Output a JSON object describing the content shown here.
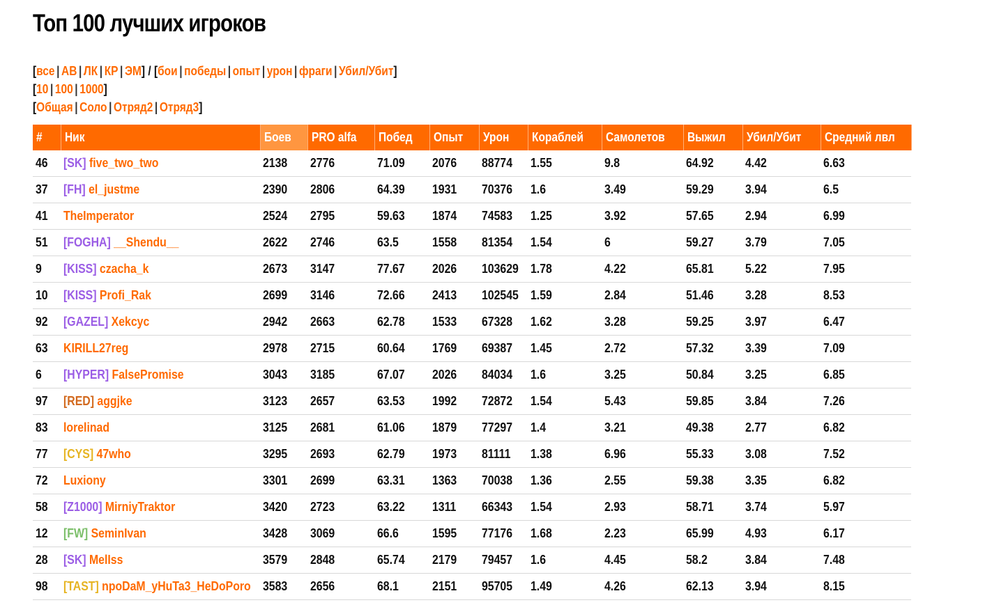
{
  "title": "Топ 100 лучших игроков",
  "filters": {
    "row1": [
      {
        "type": "br",
        "text": "["
      },
      {
        "type": "link",
        "text": "все"
      },
      {
        "type": "sep",
        "text": "|"
      },
      {
        "type": "link",
        "text": "АВ"
      },
      {
        "type": "sep",
        "text": "|"
      },
      {
        "type": "link",
        "text": "ЛК"
      },
      {
        "type": "sep",
        "text": "|"
      },
      {
        "type": "link",
        "text": "КР"
      },
      {
        "type": "sep",
        "text": "|"
      },
      {
        "type": "link",
        "text": "ЭМ"
      },
      {
        "type": "br",
        "text": "] / ["
      },
      {
        "type": "link",
        "text": "бои"
      },
      {
        "type": "sep",
        "text": "|"
      },
      {
        "type": "link",
        "text": "победы"
      },
      {
        "type": "sep",
        "text": "|"
      },
      {
        "type": "link",
        "text": "опыт"
      },
      {
        "type": "sep",
        "text": "|"
      },
      {
        "type": "link",
        "text": "урон"
      },
      {
        "type": "sep",
        "text": "|"
      },
      {
        "type": "link",
        "text": "фраги"
      },
      {
        "type": "sep",
        "text": "|"
      },
      {
        "type": "link",
        "text": "Убил/Убит"
      },
      {
        "type": "br",
        "text": "]"
      }
    ],
    "row2": [
      {
        "type": "br",
        "text": "["
      },
      {
        "type": "link",
        "text": "10"
      },
      {
        "type": "sep",
        "text": "|"
      },
      {
        "type": "link",
        "text": "100"
      },
      {
        "type": "sep",
        "text": "|"
      },
      {
        "type": "link",
        "text": "1000"
      },
      {
        "type": "br",
        "text": "]"
      }
    ],
    "row3": [
      {
        "type": "br",
        "text": "["
      },
      {
        "type": "link",
        "text": "Общая"
      },
      {
        "type": "sep",
        "text": "|"
      },
      {
        "type": "link",
        "text": "Соло"
      },
      {
        "type": "sep",
        "text": "|"
      },
      {
        "type": "link",
        "text": "Отряд2"
      },
      {
        "type": "sep",
        "text": "|"
      },
      {
        "type": "link",
        "text": "Отряд3"
      },
      {
        "type": "br",
        "text": "]"
      }
    ]
  },
  "table": {
    "headers": [
      "#",
      "Ник",
      "Боев",
      "PRO alfa",
      "Побед",
      "Опыт",
      "Урон",
      "Кораблей",
      "Самолетов",
      "Выжил",
      "Убил/Убит",
      "Средний лвл"
    ],
    "highlight_header": "Боев",
    "colors": {
      "header_bg": "#ff6a00",
      "highlight_bg": "#ff9640",
      "nick": "#ff6a00",
      "pro": "#9b3bb0",
      "clan_purple": "#9b5de5",
      "clan_orange": "#d2691e",
      "clan_yellow": "#e6b422",
      "clan_green": "#7cbf6a"
    },
    "rows": [
      {
        "rank": "46",
        "clan": "[SK]",
        "clan_color": "#9b5de5",
        "nick": "five_two_two",
        "battles": "2138",
        "pro": "2776",
        "wins": "71.09",
        "exp": "2076",
        "dmg": "88774",
        "ships": "1.55",
        "planes": "9.8",
        "survived": "64.92",
        "kd": "4.42",
        "lvl": "6.63"
      },
      {
        "rank": "37",
        "clan": "[FH]",
        "clan_color": "#9b5de5",
        "nick": "el_justme",
        "battles": "2390",
        "pro": "2806",
        "wins": "64.39",
        "exp": "1931",
        "dmg": "70376",
        "ships": "1.6",
        "planes": "3.49",
        "survived": "59.29",
        "kd": "3.94",
        "lvl": "6.5"
      },
      {
        "rank": "41",
        "clan": "",
        "clan_color": "",
        "nick": "TheImperator",
        "battles": "2524",
        "pro": "2795",
        "wins": "59.63",
        "exp": "1874",
        "dmg": "74583",
        "ships": "1.25",
        "planes": "3.92",
        "survived": "57.65",
        "kd": "2.94",
        "lvl": "6.99"
      },
      {
        "rank": "51",
        "clan": "[FOGHA]",
        "clan_color": "#9b5de5",
        "nick": "__Shendu__",
        "battles": "2622",
        "pro": "2746",
        "wins": "63.5",
        "exp": "1558",
        "dmg": "81354",
        "ships": "1.54",
        "planes": "6",
        "survived": "59.27",
        "kd": "3.79",
        "lvl": "7.05"
      },
      {
        "rank": "9",
        "clan": "[KISS]",
        "clan_color": "#9b5de5",
        "nick": "czacha_k",
        "battles": "2673",
        "pro": "3147",
        "wins": "77.67",
        "exp": "2026",
        "dmg": "103629",
        "ships": "1.78",
        "planes": "4.22",
        "survived": "65.81",
        "kd": "5.22",
        "lvl": "7.95"
      },
      {
        "rank": "10",
        "clan": "[KISS]",
        "clan_color": "#9b5de5",
        "nick": "Profi_Rak",
        "battles": "2699",
        "pro": "3146",
        "wins": "72.66",
        "exp": "2413",
        "dmg": "102545",
        "ships": "1.59",
        "planes": "2.84",
        "survived": "51.46",
        "kd": "3.28",
        "lvl": "8.53"
      },
      {
        "rank": "92",
        "clan": "[GAZEL]",
        "clan_color": "#9b5de5",
        "nick": "Xekcyc",
        "battles": "2942",
        "pro": "2663",
        "wins": "62.78",
        "exp": "1533",
        "dmg": "67328",
        "ships": "1.62",
        "planes": "3.28",
        "survived": "59.25",
        "kd": "3.97",
        "lvl": "6.47"
      },
      {
        "rank": "63",
        "clan": "",
        "clan_color": "",
        "nick": "KIRILL27reg",
        "battles": "2978",
        "pro": "2715",
        "wins": "60.64",
        "exp": "1769",
        "dmg": "69387",
        "ships": "1.45",
        "planes": "2.72",
        "survived": "57.32",
        "kd": "3.39",
        "lvl": "7.09"
      },
      {
        "rank": "6",
        "clan": "[HYPER]",
        "clan_color": "#9b5de5",
        "nick": "FalsePromise",
        "battles": "3043",
        "pro": "3185",
        "wins": "67.07",
        "exp": "2026",
        "dmg": "84034",
        "ships": "1.6",
        "planes": "3.25",
        "survived": "50.84",
        "kd": "3.25",
        "lvl": "6.85"
      },
      {
        "rank": "97",
        "clan": "[RED]",
        "clan_color": "#d2691e",
        "nick": "aggjke",
        "battles": "3123",
        "pro": "2657",
        "wins": "63.53",
        "exp": "1992",
        "dmg": "72872",
        "ships": "1.54",
        "planes": "5.43",
        "survived": "59.85",
        "kd": "3.84",
        "lvl": "7.26"
      },
      {
        "rank": "83",
        "clan": "",
        "clan_color": "",
        "nick": "lorelinad",
        "battles": "3125",
        "pro": "2681",
        "wins": "61.06",
        "exp": "1879",
        "dmg": "77297",
        "ships": "1.4",
        "planes": "3.21",
        "survived": "49.38",
        "kd": "2.77",
        "lvl": "6.82"
      },
      {
        "rank": "77",
        "clan": "[CYS]",
        "clan_color": "#e6b422",
        "nick": "47who",
        "battles": "3295",
        "pro": "2693",
        "wins": "62.79",
        "exp": "1973",
        "dmg": "81111",
        "ships": "1.38",
        "planes": "6.96",
        "survived": "55.33",
        "kd": "3.08",
        "lvl": "7.52"
      },
      {
        "rank": "72",
        "clan": "",
        "clan_color": "",
        "nick": "Luxiony",
        "battles": "3301",
        "pro": "2699",
        "wins": "63.31",
        "exp": "1363",
        "dmg": "70038",
        "ships": "1.36",
        "planes": "2.55",
        "survived": "59.38",
        "kd": "3.35",
        "lvl": "6.82"
      },
      {
        "rank": "58",
        "clan": "[Z1000]",
        "clan_color": "#9b5de5",
        "nick": "MirniyTraktor",
        "battles": "3420",
        "pro": "2723",
        "wins": "63.22",
        "exp": "1311",
        "dmg": "66343",
        "ships": "1.54",
        "planes": "2.93",
        "survived": "58.71",
        "kd": "3.74",
        "lvl": "5.97"
      },
      {
        "rank": "12",
        "clan": "[FW]",
        "clan_color": "#7cbf6a",
        "nick": "SeminIvan",
        "battles": "3428",
        "pro": "3069",
        "wins": "66.6",
        "exp": "1595",
        "dmg": "77176",
        "ships": "1.68",
        "planes": "2.23",
        "survived": "65.99",
        "kd": "4.93",
        "lvl": "6.17"
      },
      {
        "rank": "28",
        "clan": "[SK]",
        "clan_color": "#9b5de5",
        "nick": "MelIss",
        "battles": "3579",
        "pro": "2848",
        "wins": "65.74",
        "exp": "2179",
        "dmg": "79457",
        "ships": "1.6",
        "planes": "4.45",
        "survived": "58.2",
        "kd": "3.84",
        "lvl": "7.48"
      },
      {
        "rank": "98",
        "clan": "[TAST]",
        "clan_color": "#e6b422",
        "nick": "npoDaM_yHuTa3_HeDoPoro",
        "battles": "3583",
        "pro": "2656",
        "wins": "68.1",
        "exp": "2151",
        "dmg": "95705",
        "ships": "1.49",
        "planes": "4.26",
        "survived": "62.13",
        "kd": "3.94",
        "lvl": "8.15"
      }
    ]
  }
}
